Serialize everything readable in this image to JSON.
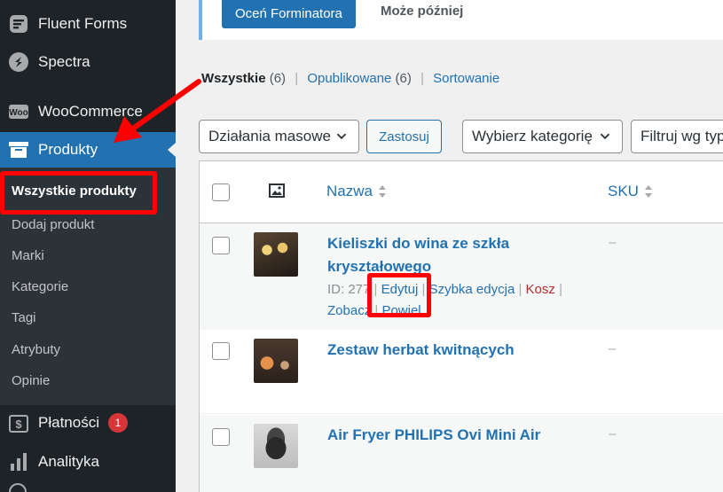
{
  "sidebar": {
    "items": [
      {
        "label": "Fluent Forms",
        "icon": "fluent-forms-icon"
      },
      {
        "label": "Spectra",
        "icon": "spectra-icon"
      },
      {
        "label": "WooCommerce",
        "icon": "woocommerce-icon"
      },
      {
        "label": "Produkty",
        "icon": "archive-box-icon"
      },
      {
        "label": "Płatności",
        "icon": "dollar-icon",
        "badge": "1"
      },
      {
        "label": "Analityka",
        "icon": "bar-chart-icon"
      }
    ],
    "submenu": [
      "Wszystkie produkty",
      "Dodaj produkt",
      "Marki",
      "Kategorie",
      "Tagi",
      "Atrybuty",
      "Opinie"
    ]
  },
  "notice": {
    "primary": "Oceń Forminatora",
    "later": "Może później"
  },
  "views": {
    "all": "Wszystkie",
    "all_count": "(6)",
    "published": "Opublikowane",
    "published_count": "(6)",
    "sorting": "Sortowanie",
    "sep": "|"
  },
  "filters": {
    "bulk": "Działania masowe",
    "apply": "Zastosuj",
    "category": "Wybierz kategorię",
    "type": "Filtruj wg typu"
  },
  "table": {
    "col_name": "Nazwa",
    "col_sku": "SKU",
    "rows": [
      {
        "name_line1": "Kieliszki do wina ze szkła",
        "name_line2": "kryształowego",
        "sku": "–",
        "id": "ID: 277",
        "edit": "Edytuj",
        "quick": "Szybka edycja",
        "trash": "Kosz",
        "view": "Zobacz",
        "preview": "Powiel"
      },
      {
        "name": "Zestaw herbat kwitnących",
        "sku": "–"
      },
      {
        "name": "Air Fryer PHILIPS Ovi Mini Air",
        "sku": "–"
      }
    ]
  },
  "colors": {
    "accent": "#2271b1",
    "sidebar": "#1d2327",
    "annotation": "#ff0000"
  }
}
